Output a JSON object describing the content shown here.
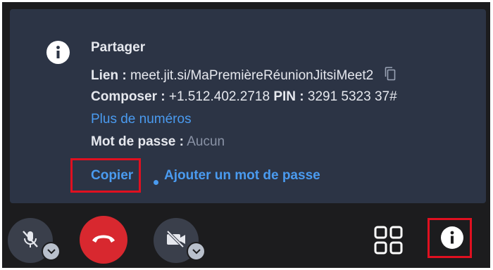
{
  "panel": {
    "title": "Partager",
    "link_label": "Lien :",
    "link_value": "meet.jit.si/MaPremièreRéunionJitsiMeet2",
    "dial_label": "Composer :",
    "dial_value": "+1.512.402.2718",
    "pin_label": "PIN :",
    "pin_value": "3291 5323 37#",
    "more_numbers": "Plus de numéros",
    "password_label": "Mot de passe :",
    "password_value": "Aucun",
    "copy_label": "Copier",
    "add_password_label": "Ajouter un mot de passe"
  },
  "colors": {
    "panel_bg": "#2c3445",
    "link": "#4a9bf0",
    "highlight": "#e01020",
    "hangup": "#d8282f"
  },
  "toolbar": {
    "icons": [
      "mic-muted-icon",
      "hangup-icon",
      "camera-off-icon",
      "tile-view-icon",
      "info-icon"
    ]
  }
}
